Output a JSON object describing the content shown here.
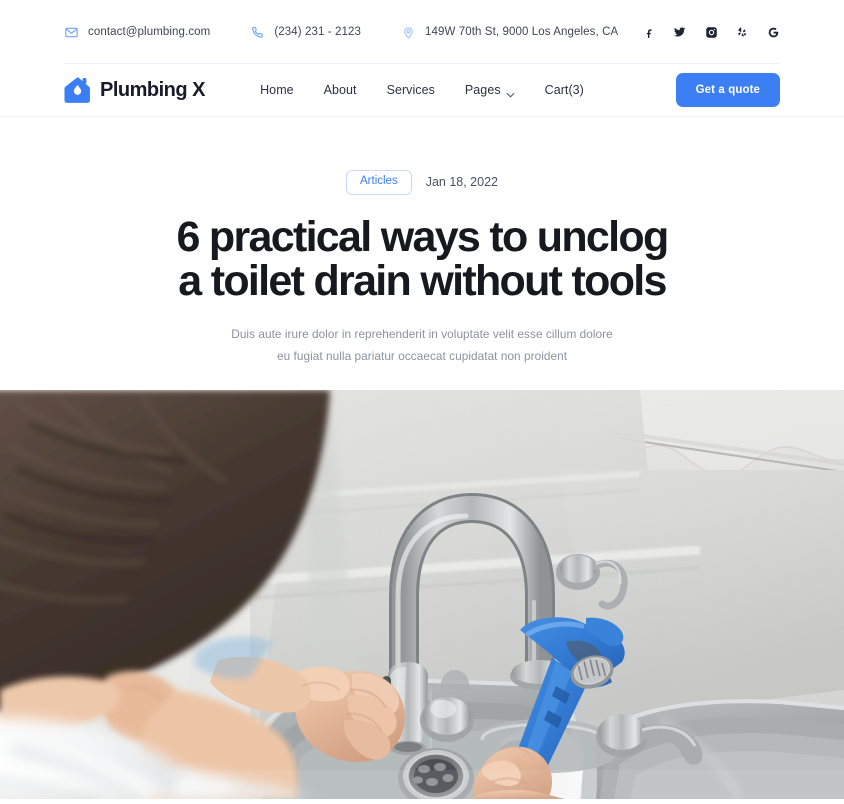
{
  "topbar": {
    "contacts": [
      {
        "icon": "mail-icon",
        "text": "contact@plumbing.com"
      },
      {
        "icon": "phone-icon",
        "text": "(234) 231 - 2123"
      },
      {
        "icon": "location-pin-icon",
        "text": "149W 70th St, 9000 Los Angeles, CA"
      }
    ],
    "socials": [
      {
        "icon": "facebook-icon",
        "label": "Facebook"
      },
      {
        "icon": "twitter-icon",
        "label": "Twitter"
      },
      {
        "icon": "instagram-icon",
        "label": "Instagram"
      },
      {
        "icon": "yelp-icon",
        "label": "Yelp"
      },
      {
        "icon": "google-icon",
        "label": "Google"
      }
    ]
  },
  "header": {
    "logo_icon": "house-water-drop-icon",
    "brand": "Plumbing X",
    "nav": [
      {
        "label": "Home",
        "dropdown": false
      },
      {
        "label": "About",
        "dropdown": false
      },
      {
        "label": "Services",
        "dropdown": false
      },
      {
        "label": "Pages",
        "dropdown": true
      },
      {
        "label": "Cart(3)",
        "dropdown": false
      }
    ],
    "cta": "Get a quote"
  },
  "article": {
    "category": "Articles",
    "date": "Jan 18, 2022",
    "title_line1": "6 practical ways to unclog",
    "title_line2": "a toilet drain without tools",
    "subtitle_line1": "Duis aute irure dolor in reprehenderit in voluptate velit esse cillum dolore",
    "subtitle_line2": "eu fugiat nulla pariatur occaecat cupidatat non proident",
    "hero_image_alt": "Plumber using a blue pipe wrench on a kitchen sink faucet"
  },
  "colors": {
    "accent": "#3c7ff5",
    "title": "#17191f",
    "muted": "#8d92a0",
    "border": "#eef1f8"
  }
}
